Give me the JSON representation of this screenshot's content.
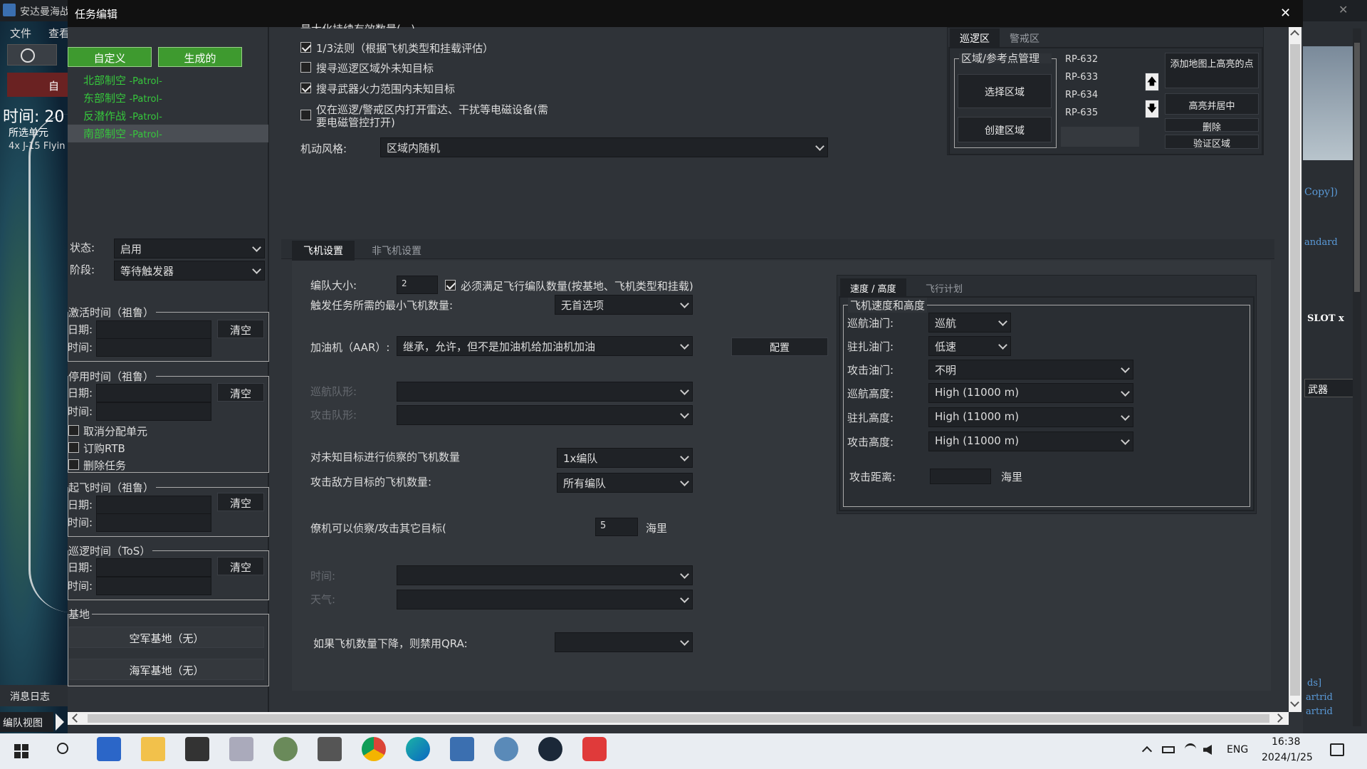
{
  "window": {
    "app_title": "安达曼海战",
    "dialog_title": "任务编辑",
    "close": "✕"
  },
  "left": {
    "menu": [
      "文件",
      "查看"
    ],
    "time_label": "时间: 20",
    "selected_unit": "所选单元",
    "unit_desc": "4x J-15 Flyin",
    "btn_custom": "自定义",
    "btn_generated": "生成的",
    "auto_label": "自",
    "missions": [
      {
        "name": "北部制空",
        "type": "-Patrol-"
      },
      {
        "name": "东部制空",
        "type": "-Patrol-"
      },
      {
        "name": "反潜作战",
        "type": "-Patrol-"
      },
      {
        "name": "南部制空",
        "type": "-Patrol-"
      }
    ],
    "status_label": "状态:",
    "status_value": "启用",
    "stage_label": "阶段:",
    "stage_value": "等待触发器",
    "activation": {
      "title": "激活时间（祖鲁）",
      "date": "日期:",
      "time": "时间:",
      "clear": "清空"
    },
    "deactivation": {
      "title": "停用时间（祖鲁）",
      "date": "日期:",
      "time": "时间:",
      "clear": "清空"
    },
    "unassign": "取消分配单元",
    "rtb": "订购RTB",
    "delete_task": "删除任务",
    "takeoff": {
      "title": "起飞时间（祖鲁）",
      "date": "日期:",
      "time": "时间:",
      "clear": "清空"
    },
    "patrol": {
      "title": "巡逻时间（ToS）",
      "date": "日期:",
      "time": "时间:",
      "clear": "清空"
    },
    "base_title": "基地",
    "airbase": "空军基地（无）",
    "navalbase": "海军基地（无）",
    "msglog": "消息日志",
    "formation_view": "编队视图"
  },
  "top": {
    "clipped_text": "最大化持续有效数量(...)",
    "rule13": "1/3法则（根据飞机类型和挂载评估）",
    "search_outside": "搜寻巡逻区域外未知目标",
    "search_weapon": "搜寻武器火力范围内未知目标",
    "emcon_line1": "仅在巡逻/警戒区内打开雷达、干扰等电磁设备(需",
    "emcon_line2": "要电磁管控打开)",
    "maneuver_label": "机动风格:",
    "maneuver_value": "区域内随机"
  },
  "zone": {
    "tab_patrol": "巡逻区",
    "tab_warn": "警戒区",
    "group_title": "区域/参考点管理",
    "select_area": "选择区域",
    "create_area": "创建区域",
    "points": [
      "RP-632",
      "RP-633",
      "RP-634",
      "RP-635"
    ],
    "add_highlight": "添加地图上高亮的点",
    "highlight_center": "高亮并居中",
    "delete": "删除",
    "verify": "验证区域"
  },
  "tabs": {
    "aircraft": "飞机设置",
    "non_aircraft": "非飞机设置"
  },
  "aircraft": {
    "group_size_label": "编队大小:",
    "group_size_value": "2",
    "must_meet": "必须满足飞行编队数量(按基地、飞机类型和挂载)",
    "min_aircraft_label": "触发任务所需的最小飞机数量:",
    "min_aircraft_value": "无首选项",
    "tanker_label": "加油机（AAR）:",
    "tanker_value": "继承，允许，但不是加油机给加油机加油",
    "config": "配置",
    "cruise_form_label": "巡航队形:",
    "attack_form_label": "攻击队形:",
    "recon_label": "对未知目标进行侦察的飞机数量",
    "recon_value": "1x编队",
    "attack_label": "攻击敌方目标的飞机数量:",
    "attack_value": "所有编队",
    "wingman_label": "僚机可以侦察/攻击其它目标(",
    "wingman_value": "5",
    "nm": "海里",
    "time_label": "时间:",
    "weather_label": "天气:",
    "qra_label": "如果飞机数量下降，则禁用QRA:"
  },
  "speed": {
    "tab_speed": "速度 / 高度",
    "tab_plan": "飞行计划",
    "group_title": "飞机速度和高度",
    "cruise_throttle": "巡航油门:",
    "cruise_throttle_v": "巡航",
    "loiter_throttle": "驻扎油门:",
    "loiter_throttle_v": "低速",
    "attack_throttle": "攻击油门:",
    "attack_throttle_v": "不明",
    "cruise_alt": "巡航高度:",
    "cruise_alt_v": "High (11000 m)",
    "loiter_alt": "驻扎高度:",
    "loiter_alt_v": "High (11000 m)",
    "attack_alt": "攻击高度:",
    "attack_alt_v": "High (11000 m)",
    "attack_dist": "攻击距离:",
    "nm": "海里"
  },
  "right": {
    "copy": "Copy])",
    "standard": "andard",
    "slot": "SLOT x",
    "weapon": "武器",
    "ds": "ds]",
    "cartrid1": "artrid",
    "cartrid2": "artrid"
  },
  "taskbar": {
    "time": "16:38",
    "date": "2024/1/25",
    "lang": "ENG"
  },
  "colors": {
    "accent_green": "#3e9a2f",
    "mission_green": "#36c83c"
  }
}
